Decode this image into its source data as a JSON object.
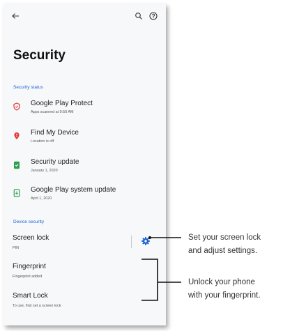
{
  "toolbar": {
    "back_icon": "arrow-left-icon",
    "search_icon": "search-icon",
    "help_icon": "help-circle-icon"
  },
  "page": {
    "title": "Security"
  },
  "security_status": {
    "header": "Security status",
    "items": [
      {
        "title": "Google Play Protect",
        "subtitle": "Apps scanned at 9:50 AM",
        "icon": "shield-icon",
        "color": "#e53935"
      },
      {
        "title": "Find My Device",
        "subtitle": "Location is off",
        "icon": "location-pin-icon",
        "color": "#e53935"
      },
      {
        "title": "Security update",
        "subtitle": "January 1, 2020",
        "icon": "security-update-icon",
        "color": "#2e9e4f"
      },
      {
        "title": "Google Play system update",
        "subtitle": "April 1, 2020",
        "icon": "system-update-icon",
        "color": "#2e9e4f"
      }
    ]
  },
  "device_security": {
    "header": "Device security",
    "items": [
      {
        "title": "Screen lock",
        "subtitle": "PIN"
      },
      {
        "title": "Fingerprint",
        "subtitle": "Fingerprint added"
      },
      {
        "title": "Smart Lock",
        "subtitle": "To use, first set a screen lock"
      }
    ],
    "settings_icon": "gear-icon",
    "accent_color": "#1a62d6"
  },
  "callouts": {
    "screen_lock": {
      "line1": "Set your screen lock",
      "line2": "and adjust settings."
    },
    "fingerprint": {
      "line1": "Unlock your phone",
      "line2": "with your fingerprint."
    }
  }
}
